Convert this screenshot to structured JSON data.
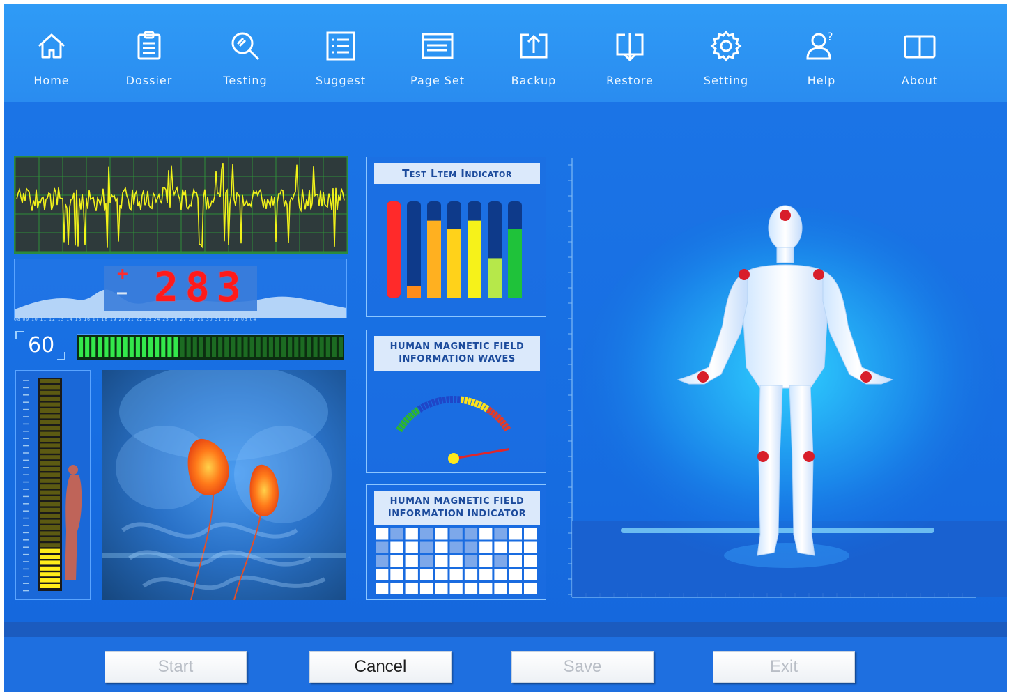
{
  "toolbar": {
    "items": [
      {
        "label": "Home",
        "icon": "home-icon"
      },
      {
        "label": "Dossier",
        "icon": "clipboard-icon"
      },
      {
        "label": "Testing",
        "icon": "magnifier-icon"
      },
      {
        "label": "Suggest",
        "icon": "list-icon"
      },
      {
        "label": "Page Set",
        "icon": "window-icon"
      },
      {
        "label": "Backup",
        "icon": "upload-icon"
      },
      {
        "label": "Restore",
        "icon": "download-icon"
      },
      {
        "label": "Setting",
        "icon": "gear-icon"
      },
      {
        "label": "Help",
        "icon": "user-question-icon"
      },
      {
        "label": "About",
        "icon": "book-icon"
      }
    ]
  },
  "readout": {
    "sign_plus": "+",
    "sign_minus": "−",
    "digits": "283",
    "level_value": "60",
    "level_fill": 0.37,
    "tick_labels": "08 09 10 11 12 13 14 15 16 17 18 19 20 21 22 23 24 25 26 27 28 29 30 31 01 02 03 04"
  },
  "panels": {
    "test_item": {
      "title": "Test Ltem Indicator"
    },
    "waves": {
      "title_line1": "HUMAN MAGNETIC FIELD",
      "title_line2": "INFORMATION WAVES"
    },
    "indicator": {
      "title_line1": "HUMAN MAGNETIC FIELD",
      "title_line2": "INFORMATION INDICATOR"
    }
  },
  "test_bars": [
    {
      "color": "#ff2a2a",
      "fill": 1.0
    },
    {
      "color": "#ff8c1a",
      "fill": 0.12
    },
    {
      "color": "#ffb020",
      "fill": 0.8
    },
    {
      "color": "#ffd21a",
      "fill": 0.71
    },
    {
      "color": "#f6f21a",
      "fill": 0.8
    },
    {
      "color": "#b6e84a",
      "fill": 0.41
    },
    {
      "color": "#1fc23a",
      "fill": 0.71
    }
  ],
  "gauge": {
    "needle_value": 0.78
  },
  "vmeter": {
    "fill": 0.2
  },
  "footer": {
    "start": "Start",
    "cancel": "Cancel",
    "save": "Save",
    "exit": "Exit"
  },
  "colors": {
    "accent": "#1565d8",
    "toolbar": "#2f9bf6",
    "led_red": "#ff1a1a",
    "marker_red": "#d81e2a"
  }
}
